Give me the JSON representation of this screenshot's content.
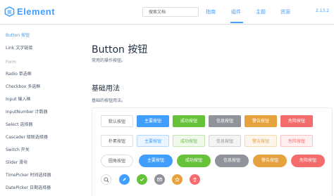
{
  "header": {
    "logo_text": "Element",
    "search_placeholder": "搜索文档",
    "nav": [
      "指南",
      "组件",
      "主题",
      "资源"
    ],
    "active_nav": "组件",
    "version": "2.13.2"
  },
  "sidebar": {
    "items_top": [
      "Button 按钮",
      "Link 文字链接"
    ],
    "group": "Form",
    "items_form": [
      "Radio 单选框",
      "Checkbox 多选框",
      "Input 输入框",
      "InputNumber 计数器",
      "Select 选择器",
      "Cascader 级联选择器",
      "Switch 开关",
      "Slider 滑块",
      "TimePicker 时间选择器",
      "DatePicker 日期选择器"
    ]
  },
  "main": {
    "title": "Button 按钮",
    "subtitle": "常用的操作按钮。",
    "section_title": "基础用法",
    "section_desc": "基础的按钮用法。"
  },
  "buttons": {
    "row1": [
      "默认按钮",
      "主要按钮",
      "成功按钮",
      "信息按钮",
      "警告按钮",
      "危险按钮"
    ],
    "row2": [
      "朴素按钮",
      "主要按钮",
      "成功按钮",
      "信息按钮",
      "警告按钮",
      "危险按钮"
    ],
    "row3": [
      "圆角按钮",
      "主要按钮",
      "成功按钮",
      "信息按钮",
      "警告按钮",
      "危险按钮"
    ],
    "row4_icons": [
      "search-icon",
      "edit-icon",
      "check-icon",
      "message-icon",
      "star-icon",
      "delete-icon"
    ]
  },
  "colors": {
    "primary": "#409eff",
    "success": "#67c23a",
    "info": "#909399",
    "warning": "#e6a23c",
    "danger": "#f56c6c"
  }
}
